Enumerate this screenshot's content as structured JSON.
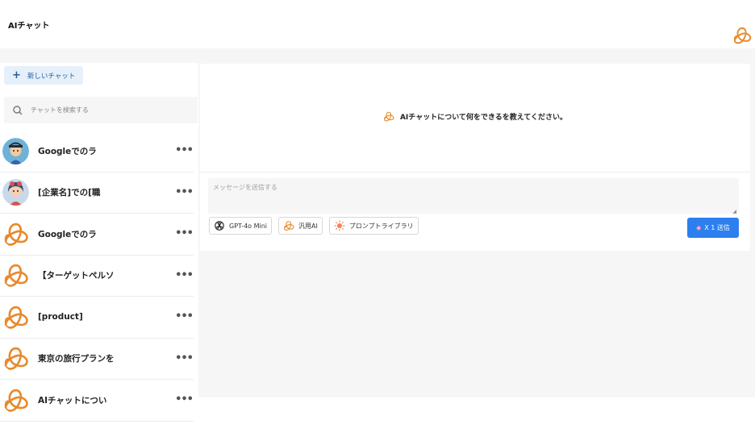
{
  "header": {
    "title": "AIチャット",
    "logo_icon": "brand-knot-icon"
  },
  "sidebar": {
    "new_chat_label": "新しいチャット",
    "search_placeholder": "チャットを検索する",
    "chats": [
      {
        "title": "Googleでのラ",
        "avatar": "character-avatar-1"
      },
      {
        "title": "[企業名]での[職",
        "avatar": "character-avatar-2"
      },
      {
        "title": "Googleでのラ",
        "avatar": "brand-knot-icon"
      },
      {
        "title": "【ターゲットペルソ",
        "avatar": "brand-knot-icon"
      },
      {
        "title": "[product]",
        "avatar": "brand-knot-icon"
      },
      {
        "title": "東京の旅行プランを",
        "avatar": "brand-knot-icon"
      },
      {
        "title": "AIチャットについ",
        "avatar": "brand-knot-icon"
      }
    ],
    "more_label": "•••"
  },
  "main": {
    "prompt": "AIチャットについて何をできるを教えてください。",
    "message_placeholder": "メッセージを送信する",
    "tools": [
      {
        "label": "GPT-4o Mini",
        "icon": "openai-icon"
      },
      {
        "label": "汎用AI",
        "icon": "brand-knot-icon"
      },
      {
        "label": "プロンプトライブラリ",
        "icon": "sparkle-icon"
      }
    ],
    "send_label": "X 1 送信",
    "send_icon": "gem-icon"
  },
  "colors": {
    "accent": "#2d7ff0",
    "brand": "#f0a13c",
    "new_chat_bg": "#e5f0fb"
  }
}
